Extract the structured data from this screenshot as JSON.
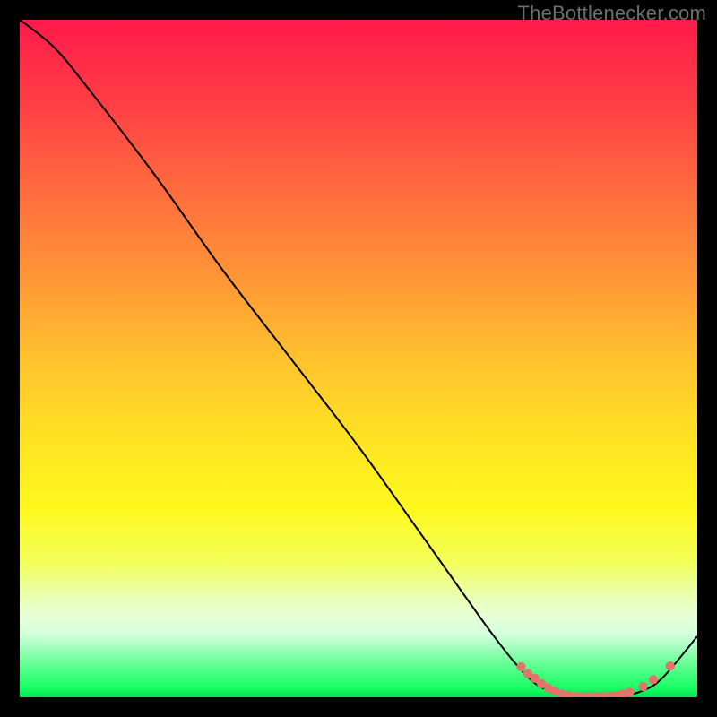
{
  "watermark": "TheBottlenecker.com",
  "chart_data": {
    "type": "line",
    "title": "",
    "xlabel": "",
    "ylabel": "",
    "xlim": [
      0,
      100
    ],
    "ylim": [
      0,
      100
    ],
    "grid": false,
    "series": [
      {
        "name": "curve",
        "points": [
          {
            "x": 0,
            "y": 100
          },
          {
            "x": 5,
            "y": 96
          },
          {
            "x": 10,
            "y": 90
          },
          {
            "x": 20,
            "y": 77
          },
          {
            "x": 30,
            "y": 63
          },
          {
            "x": 40,
            "y": 50
          },
          {
            "x": 50,
            "y": 37
          },
          {
            "x": 60,
            "y": 23
          },
          {
            "x": 70,
            "y": 9
          },
          {
            "x": 75,
            "y": 3
          },
          {
            "x": 78,
            "y": 1
          },
          {
            "x": 82,
            "y": 0
          },
          {
            "x": 88,
            "y": 0
          },
          {
            "x": 92,
            "y": 1
          },
          {
            "x": 95,
            "y": 3
          },
          {
            "x": 100,
            "y": 9
          }
        ]
      }
    ],
    "markers": [
      {
        "x": 74,
        "y": 4.5
      },
      {
        "x": 75,
        "y": 3.5
      },
      {
        "x": 76,
        "y": 2.8
      },
      {
        "x": 77,
        "y": 2.0
      },
      {
        "x": 78,
        "y": 1.4
      },
      {
        "x": 79,
        "y": 0.9
      },
      {
        "x": 80,
        "y": 0.5
      },
      {
        "x": 81,
        "y": 0.3
      },
      {
        "x": 82,
        "y": 0.15
      },
      {
        "x": 83,
        "y": 0.1
      },
      {
        "x": 84,
        "y": 0.1
      },
      {
        "x": 85,
        "y": 0.1
      },
      {
        "x": 86,
        "y": 0.1
      },
      {
        "x": 87,
        "y": 0.15
      },
      {
        "x": 88,
        "y": 0.25
      },
      {
        "x": 89,
        "y": 0.45
      },
      {
        "x": 90,
        "y": 0.75
      },
      {
        "x": 92,
        "y": 1.6
      },
      {
        "x": 93.5,
        "y": 2.6
      },
      {
        "x": 96,
        "y": 4.6
      }
    ],
    "gradient_stops": [
      {
        "offset": 0.0,
        "color": "#ff1a4b"
      },
      {
        "offset": 0.12,
        "color": "#ff3d45"
      },
      {
        "offset": 0.25,
        "color": "#ff6b3e"
      },
      {
        "offset": 0.38,
        "color": "#ff9636"
      },
      {
        "offset": 0.5,
        "color": "#ffc22e"
      },
      {
        "offset": 0.62,
        "color": "#ffe324"
      },
      {
        "offset": 0.72,
        "color": "#fff81c"
      },
      {
        "offset": 0.8,
        "color": "#f3ff5a"
      },
      {
        "offset": 0.85,
        "color": "#eaffb0"
      },
      {
        "offset": 0.88,
        "color": "#e7ffd6"
      },
      {
        "offset": 0.905,
        "color": "#d5ffdd"
      },
      {
        "offset": 0.925,
        "color": "#a8ffc1"
      },
      {
        "offset": 0.945,
        "color": "#74ff9f"
      },
      {
        "offset": 0.965,
        "color": "#45ff80"
      },
      {
        "offset": 0.985,
        "color": "#1aff63"
      },
      {
        "offset": 1.0,
        "color": "#00e756"
      }
    ],
    "marker_color": "#e2746c",
    "line_color": "#000000"
  }
}
